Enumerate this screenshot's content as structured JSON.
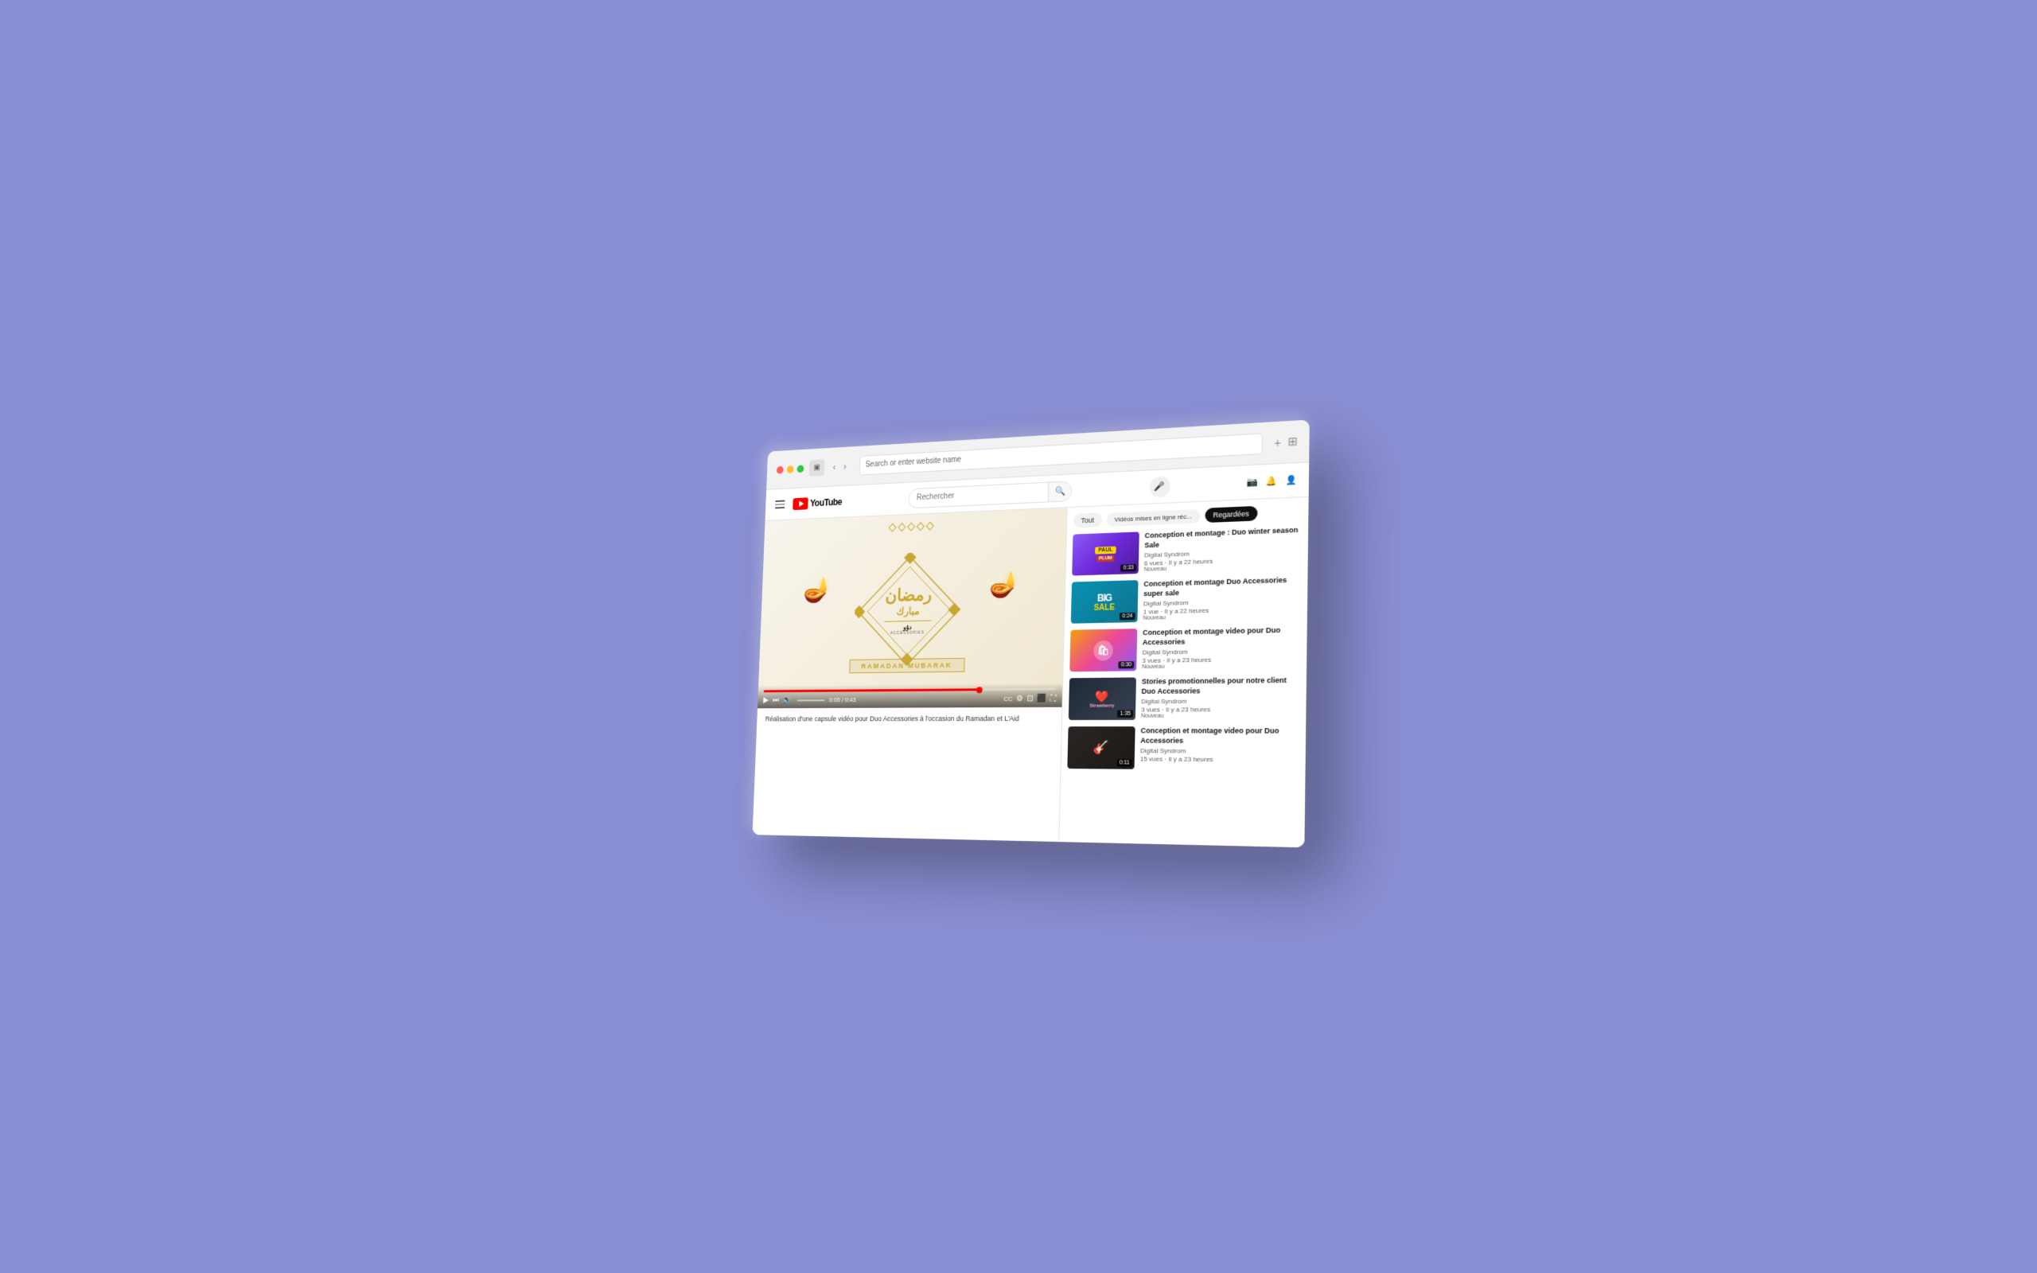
{
  "browser": {
    "address_bar_placeholder": "Search or enter website name",
    "tab_count_icon": "⊞",
    "add_tab_icon": "+",
    "sidebar_icon": "▣",
    "back_icon": "‹",
    "forward_icon": "›"
  },
  "youtube": {
    "logo_text": "YouTube",
    "search_placeholder": "Rechercher",
    "filter_tabs": [
      {
        "label": "Tout",
        "active": false
      },
      {
        "label": "Vidéos mises en ligne réc...",
        "active": false
      },
      {
        "label": "Regardées",
        "active": true
      }
    ],
    "video_playing": {
      "description": "Réalisation d'une capsule vidéo pour Duo Accessories à l'occasion du Ramadan et L'Aid",
      "time_current": "0:05",
      "time_total": "0:43",
      "subtitle": "RAMADAN MUBARAK"
    },
    "sidebar_videos": [
      {
        "title": "Conception et montage : Duo winter season Sale",
        "channel": "Digital Syndrom",
        "views": "6 vues",
        "time_ago": "Il y a 22 heures",
        "badge": "Nouveau",
        "duration": "0:33",
        "thumb_type": "1"
      },
      {
        "title": "Conception et montage Duo Accessories super sale",
        "channel": "Digital Syndrom",
        "views": "1 vue",
        "time_ago": "Il y a 22 heures",
        "badge": "Nouveau",
        "duration": "0:24",
        "thumb_type": "2"
      },
      {
        "title": "Conception et montage video pour Duo Accessories",
        "channel": "Digital Syndrom",
        "views": "3 vues",
        "time_ago": "Il y a 23 heures",
        "badge": "Nouveau",
        "duration": "0:30",
        "thumb_type": "3"
      },
      {
        "title": "Stories promotionnelles pour notre client Duo Accessories",
        "channel": "Digital Syndrom",
        "views": "3 vues",
        "time_ago": "Il y a 23 heures",
        "badge": "Nouveau",
        "duration": "1:35",
        "thumb_type": "4"
      },
      {
        "title": "Conception et montage video pour Duo Accessories",
        "channel": "Digital Syndrom",
        "views": "15 vues",
        "time_ago": "Il y a 23 heures",
        "badge": "",
        "duration": "0:11",
        "thumb_type": "5"
      }
    ]
  },
  "icons": {
    "hamburger": "☰",
    "search": "🔍",
    "mic": "🎤",
    "bell": "🔔",
    "camera": "📷",
    "play": "▶",
    "pause": "⏸",
    "skip": "⏭",
    "volume": "🔊",
    "settings": "⚙",
    "cc": "CC",
    "fullscreen": "⛶",
    "theater": "⬛",
    "miniplayer": "⊡"
  },
  "colors": {
    "yt_red": "#ff0000",
    "bg": "#8b8fd4",
    "active_tab": "#0f0f0f",
    "progress_red": "#ff0000"
  }
}
